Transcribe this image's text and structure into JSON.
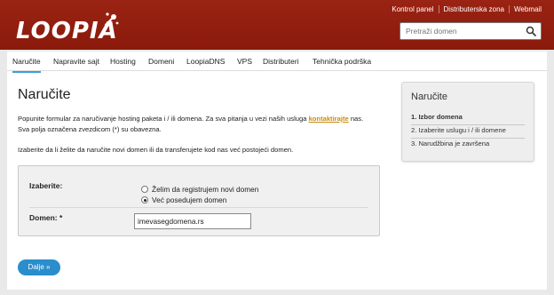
{
  "header": {
    "logo": "LOOPIA",
    "top_links": [
      "Kontrol panel",
      "Distributerska zona",
      "Webmail"
    ],
    "search": {
      "placeholder": "Pretraži domen",
      "icon": "search-icon"
    }
  },
  "nav": {
    "items": [
      "Naručite",
      "Napravite sajt",
      "Hosting",
      "Domeni",
      "LoopiaDNS",
      "VPS",
      "Distributeri",
      "Tehnička podrška"
    ],
    "active_index": 0
  },
  "main": {
    "title": "Naručite",
    "intro_1": "Popunite formular za naručivanje hosting paketa i / ili domena. Za sva pitanja u vezi naših usluga ",
    "intro_link": "kontaktirajte",
    "intro_2": " nas.",
    "intro_3": "Sva polja označena zvezdicom (*) su obavezna.",
    "instruction": "Izaberite da li želite da naručite novi domen ili da transferujete kod nas već postojeći domen.",
    "form": {
      "choose_label": "Izaberite:",
      "options": [
        {
          "label": "Želim da registrujem novi domen",
          "selected": false
        },
        {
          "label": "Već posedujem domen",
          "selected": true
        }
      ],
      "domain_label": "Domen: *",
      "domain_value": "imevasegdomena.rs"
    },
    "next_button": "Dalje »"
  },
  "sidebar": {
    "title": "Naručite",
    "steps": [
      "1. Izbor domena",
      "2. Izaberite uslugu i / ili domene",
      "3. Narudžbina je završena"
    ],
    "current_step": 0
  },
  "colors": {
    "header": "#9a2313",
    "accent": "#2a8dcc",
    "link": "#c98b10"
  }
}
